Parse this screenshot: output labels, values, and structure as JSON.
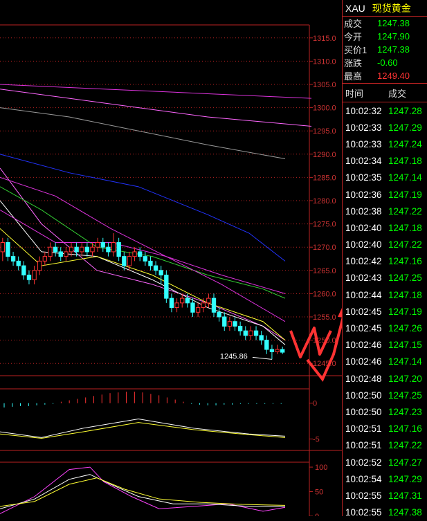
{
  "header": {
    "symbol": "XAU",
    "name": "现货黄金"
  },
  "quote": [
    {
      "label": "成交",
      "value": "1247.38",
      "color": "#00ff00"
    },
    {
      "label": "今开",
      "value": "1247.90",
      "color": "#00ff00"
    },
    {
      "label": "买价1",
      "value": "1247.38",
      "color": "#00ff00"
    },
    {
      "label": "涨跌",
      "value": "-0.60",
      "color": "#00ff00"
    },
    {
      "label": "最高",
      "value": "1249.40",
      "color": "#ff3333"
    }
  ],
  "ticks_header": {
    "time": "时间",
    "price": "成交"
  },
  "ticks": [
    {
      "time": "10:02:32",
      "price": "1247.28"
    },
    {
      "time": "10:02:33",
      "price": "1247.29"
    },
    {
      "time": "10:02:33",
      "price": "1247.24"
    },
    {
      "time": "10:02:34",
      "price": "1247.18"
    },
    {
      "time": "10:02:35",
      "price": "1247.14"
    },
    {
      "time": "10:02:36",
      "price": "1247.19"
    },
    {
      "time": "10:02:38",
      "price": "1247.22"
    },
    {
      "time": "10:02:40",
      "price": "1247.18"
    },
    {
      "time": "10:02:40",
      "price": "1247.22"
    },
    {
      "time": "10:02:42",
      "price": "1247.16"
    },
    {
      "time": "10:02:43",
      "price": "1247.25"
    },
    {
      "time": "10:02:44",
      "price": "1247.18"
    },
    {
      "time": "10:02:45",
      "price": "1247.19"
    },
    {
      "time": "10:02:45",
      "price": "1247.26"
    },
    {
      "time": "10:02:46",
      "price": "1247.15"
    },
    {
      "time": "10:02:46",
      "price": "1247.14"
    },
    {
      "time": "10:02:48",
      "price": "1247.20"
    },
    {
      "time": "10:02:50",
      "price": "1247.25"
    },
    {
      "time": "10:02:50",
      "price": "1247.23"
    },
    {
      "time": "10:02:51",
      "price": "1247.16"
    },
    {
      "time": "10:02:51",
      "price": "1247.22"
    },
    {
      "time": "10:02:52",
      "price": "1247.27"
    },
    {
      "time": "10:02:54",
      "price": "1247.29"
    },
    {
      "time": "10:02:55",
      "price": "1247.31"
    },
    {
      "time": "10:02:55",
      "price": "1247.38"
    }
  ],
  "chart_data": {
    "type": "candlestick",
    "price_axis": {
      "ticks": [
        "1315.0",
        "1310.0",
        "1305.0",
        "1300.0",
        "1295.0",
        "1290.0",
        "1285.0",
        "1280.0",
        "1275.0",
        "1270.0",
        "1265.0",
        "1260.0",
        "1255.0",
        "1250.0",
        "1245.0"
      ],
      "ylim": [
        1242.5,
        1317.5
      ]
    },
    "low_annotation": {
      "text": "1245.86",
      "value": 1245.86
    },
    "candles": [
      [
        1269,
        1271,
        1267,
        1272
      ],
      [
        1271,
        1268,
        1267,
        1272
      ],
      [
        1268,
        1267,
        1266,
        1269
      ],
      [
        1267,
        1266,
        1265,
        1268
      ],
      [
        1266,
        1264,
        1263,
        1267
      ],
      [
        1264,
        1263,
        1262,
        1265
      ],
      [
        1263,
        1265,
        1262,
        1266
      ],
      [
        1265,
        1267,
        1264,
        1268
      ],
      [
        1267,
        1268,
        1266,
        1269
      ],
      [
        1268,
        1270,
        1267,
        1271
      ],
      [
        1270,
        1269,
        1268,
        1271
      ],
      [
        1269,
        1268,
        1267,
        1270
      ],
      [
        1268,
        1269,
        1267,
        1270
      ],
      [
        1269,
        1270,
        1268,
        1271
      ],
      [
        1270,
        1269,
        1268,
        1271
      ],
      [
        1269,
        1270,
        1268,
        1271
      ],
      [
        1270,
        1269,
        1268,
        1271
      ],
      [
        1269,
        1270,
        1268,
        1271
      ],
      [
        1270,
        1271,
        1269,
        1272
      ],
      [
        1271,
        1270,
        1269,
        1272
      ],
      [
        1270,
        1269,
        1268,
        1271
      ],
      [
        1269,
        1271,
        1268,
        1273
      ],
      [
        1271,
        1268,
        1267,
        1272
      ],
      [
        1268,
        1266,
        1265,
        1269
      ],
      [
        1266,
        1268,
        1265,
        1269
      ],
      [
        1268,
        1269,
        1267,
        1270
      ],
      [
        1269,
        1268,
        1267,
        1270
      ],
      [
        1268,
        1267,
        1266,
        1269
      ],
      [
        1267,
        1266,
        1265,
        1268
      ],
      [
        1266,
        1265,
        1264,
        1267
      ],
      [
        1265,
        1264,
        1262,
        1266
      ],
      [
        1264,
        1259,
        1258,
        1265
      ],
      [
        1259,
        1257,
        1256,
        1260
      ],
      [
        1257,
        1258,
        1256,
        1259
      ],
      [
        1258,
        1259,
        1257,
        1260
      ],
      [
        1259,
        1258,
        1257,
        1260
      ],
      [
        1258,
        1256,
        1255,
        1259
      ],
      [
        1256,
        1257,
        1255,
        1258
      ],
      [
        1257,
        1258,
        1256,
        1259
      ],
      [
        1258,
        1259,
        1257,
        1260
      ],
      [
        1259,
        1256,
        1255,
        1260
      ],
      [
        1256,
        1255,
        1254,
        1257
      ],
      [
        1255,
        1253,
        1252,
        1256
      ],
      [
        1253,
        1254,
        1252,
        1255
      ],
      [
        1254,
        1253,
        1252,
        1255
      ],
      [
        1253,
        1252,
        1251,
        1254
      ],
      [
        1252,
        1251,
        1250,
        1253
      ],
      [
        1251,
        1252,
        1250,
        1253
      ],
      [
        1252,
        1251,
        1250,
        1253
      ],
      [
        1251,
        1250,
        1249,
        1252
      ],
      [
        1250,
        1248,
        1247,
        1251
      ],
      [
        1248,
        1247.5,
        1245.86,
        1249
      ],
      [
        1247.5,
        1248,
        1247,
        1249
      ],
      [
        1248,
        1247.4,
        1247,
        1248.6
      ]
    ],
    "ma_lines": [
      {
        "color": "#ff66ff",
        "points": [
          [
            0,
            1287
          ],
          [
            60,
            1275
          ],
          [
            140,
            1265
          ],
          [
            220,
            1262
          ],
          [
            300,
            1258
          ],
          [
            380,
            1253
          ],
          [
            412,
            1250
          ]
        ]
      },
      {
        "color": "#ffffff",
        "points": [
          [
            0,
            1280
          ],
          [
            60,
            1269
          ],
          [
            140,
            1268
          ],
          [
            220,
            1263
          ],
          [
            300,
            1257
          ],
          [
            380,
            1253
          ],
          [
            412,
            1249
          ]
        ]
      },
      {
        "color": "#ffff33",
        "points": [
          [
            0,
            1274
          ],
          [
            60,
            1266
          ],
          [
            140,
            1268
          ],
          [
            220,
            1264
          ],
          [
            300,
            1258
          ],
          [
            380,
            1254
          ],
          [
            412,
            1250
          ]
        ]
      },
      {
        "color": "#33cc33",
        "points": [
          [
            0,
            1283
          ],
          [
            60,
            1278
          ],
          [
            140,
            1270
          ],
          [
            220,
            1268
          ],
          [
            300,
            1264
          ],
          [
            380,
            1261
          ],
          [
            412,
            1259
          ]
        ]
      },
      {
        "color": "#dd33dd",
        "points": [
          [
            0,
            1278
          ],
          [
            80,
            1271
          ],
          [
            160,
            1271
          ],
          [
            240,
            1268
          ],
          [
            320,
            1264
          ],
          [
            412,
            1260
          ]
        ]
      },
      {
        "color": "#dd33dd",
        "points": [
          [
            0,
            1285
          ],
          [
            80,
            1281
          ],
          [
            160,
            1274
          ],
          [
            240,
            1268
          ],
          [
            320,
            1262
          ],
          [
            412,
            1254
          ]
        ]
      },
      {
        "color": "#2233ff",
        "points": [
          [
            0,
            1290
          ],
          [
            100,
            1286
          ],
          [
            200,
            1283
          ],
          [
            300,
            1277
          ],
          [
            360,
            1273
          ],
          [
            412,
            1267
          ]
        ]
      },
      {
        "color": "#999999",
        "points": [
          [
            0,
            1300
          ],
          [
            100,
            1298
          ],
          [
            200,
            1295
          ],
          [
            300,
            1292
          ],
          [
            412,
            1289
          ]
        ]
      },
      {
        "color": "#ff66ff",
        "points": [
          [
            0,
            1304
          ],
          [
            150,
            1301
          ],
          [
            300,
            1298
          ],
          [
            450,
            1296
          ]
        ]
      },
      {
        "color": "#dd33dd",
        "points": [
          [
            0,
            1305
          ],
          [
            150,
            1304
          ],
          [
            300,
            1303
          ],
          [
            450,
            1302
          ]
        ]
      }
    ],
    "indicator1": {
      "axis_ticks": [
        "0",
        "-5"
      ],
      "ylim": [
        -6.5,
        2
      ],
      "histogram": [
        -0.6,
        -0.5,
        -0.4,
        -0.4,
        -0.3,
        -0.2,
        -0.1,
        0.2,
        0.4,
        0.6,
        0.8,
        1.0,
        1.2,
        1.4,
        1.5,
        1.6,
        1.6,
        1.5,
        1.3,
        1.1,
        0.8,
        0.5,
        0.2,
        -0.1,
        -0.2,
        -0.3,
        -0.3,
        -0.2,
        -0.2,
        -0.1,
        -0.1,
        -0.1,
        -0.1,
        -0.1,
        -0.1
      ],
      "lines": [
        {
          "color": "#ffffff",
          "points": [
            [
              0,
              -4.0
            ],
            [
              60,
              -4.8
            ],
            [
              120,
              -3.5
            ],
            [
              200,
              -2.2
            ],
            [
              280,
              -3.5
            ],
            [
              360,
              -4.3
            ],
            [
              412,
              -4.6
            ]
          ]
        },
        {
          "color": "#ffff33",
          "points": [
            [
              0,
              -4.3
            ],
            [
              60,
              -4.9
            ],
            [
              120,
              -4.0
            ],
            [
              200,
              -2.7
            ],
            [
              280,
              -3.7
            ],
            [
              360,
              -4.4
            ],
            [
              412,
              -4.8
            ]
          ]
        }
      ]
    },
    "indicator2": {
      "axis_ticks": [
        "100",
        "50",
        "0"
      ],
      "ylim": [
        0,
        110
      ],
      "lines": [
        {
          "color": "#ff44ff",
          "points": [
            [
              0,
              5
            ],
            [
              50,
              40
            ],
            [
              100,
              95
            ],
            [
              130,
              100
            ],
            [
              150,
              70
            ],
            [
              190,
              40
            ],
            [
              230,
              15
            ],
            [
              280,
              20
            ],
            [
              330,
              25
            ],
            [
              380,
              10
            ],
            [
              412,
              18
            ]
          ]
        },
        {
          "color": "#ffffff",
          "points": [
            [
              0,
              15
            ],
            [
              50,
              35
            ],
            [
              100,
              75
            ],
            [
              130,
              85
            ],
            [
              160,
              65
            ],
            [
              200,
              40
            ],
            [
              250,
              25
            ],
            [
              300,
              25
            ],
            [
              360,
              20
            ],
            [
              412,
              20
            ]
          ]
        },
        {
          "color": "#ffff33",
          "points": [
            [
              0,
              20
            ],
            [
              50,
              30
            ],
            [
              100,
              65
            ],
            [
              140,
              78
            ],
            [
              180,
              55
            ],
            [
              230,
              35
            ],
            [
              290,
              28
            ],
            [
              350,
              24
            ],
            [
              412,
              22
            ]
          ]
        }
      ]
    }
  },
  "annotation": {
    "color": "#ff3333"
  }
}
